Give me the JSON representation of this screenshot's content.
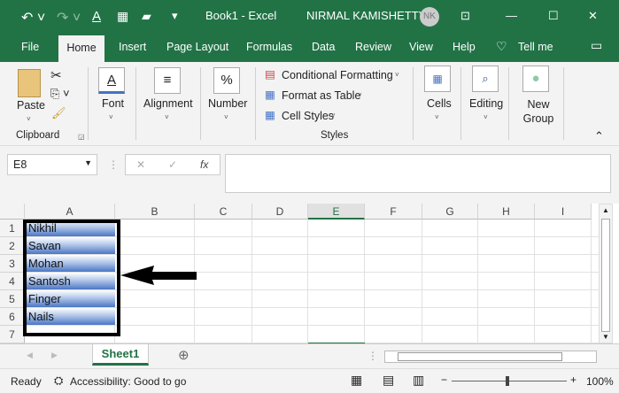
{
  "titlebar": {
    "doc_title": "Book1  -  Excel",
    "user": "NIRMAL KAMISHETTY",
    "avatar": "NK"
  },
  "tabs": [
    "File",
    "Home",
    "Insert",
    "Page Layout",
    "Formulas",
    "Data",
    "Review",
    "View",
    "Help",
    "Tell me"
  ],
  "ribbon": {
    "paste": "Paste",
    "clipboard": "Clipboard",
    "font": "Font",
    "alignment": "Alignment",
    "number": "Number",
    "conditional": "Conditional Formatting",
    "format_table": "Format as Table",
    "cell_styles": "Cell Styles",
    "styles": "Styles",
    "cells": "Cells",
    "editing": "Editing",
    "new_group": "New Group"
  },
  "formula": {
    "name_box": "E8",
    "value": "",
    "fx": "fx"
  },
  "columns": [
    "A",
    "B",
    "C",
    "D",
    "E",
    "F",
    "G",
    "H",
    "I"
  ],
  "rows": [
    "1",
    "2",
    "3",
    "4",
    "5",
    "6",
    "7"
  ],
  "cells": [
    "Nikhil",
    "Savan",
    "Mohan",
    "Santosh",
    "Finger",
    "Nails"
  ],
  "sheet": {
    "tab": "Sheet1"
  },
  "status": {
    "ready": "Ready",
    "accessibility": "Accessibility: Good to go",
    "zoom": "100%"
  }
}
